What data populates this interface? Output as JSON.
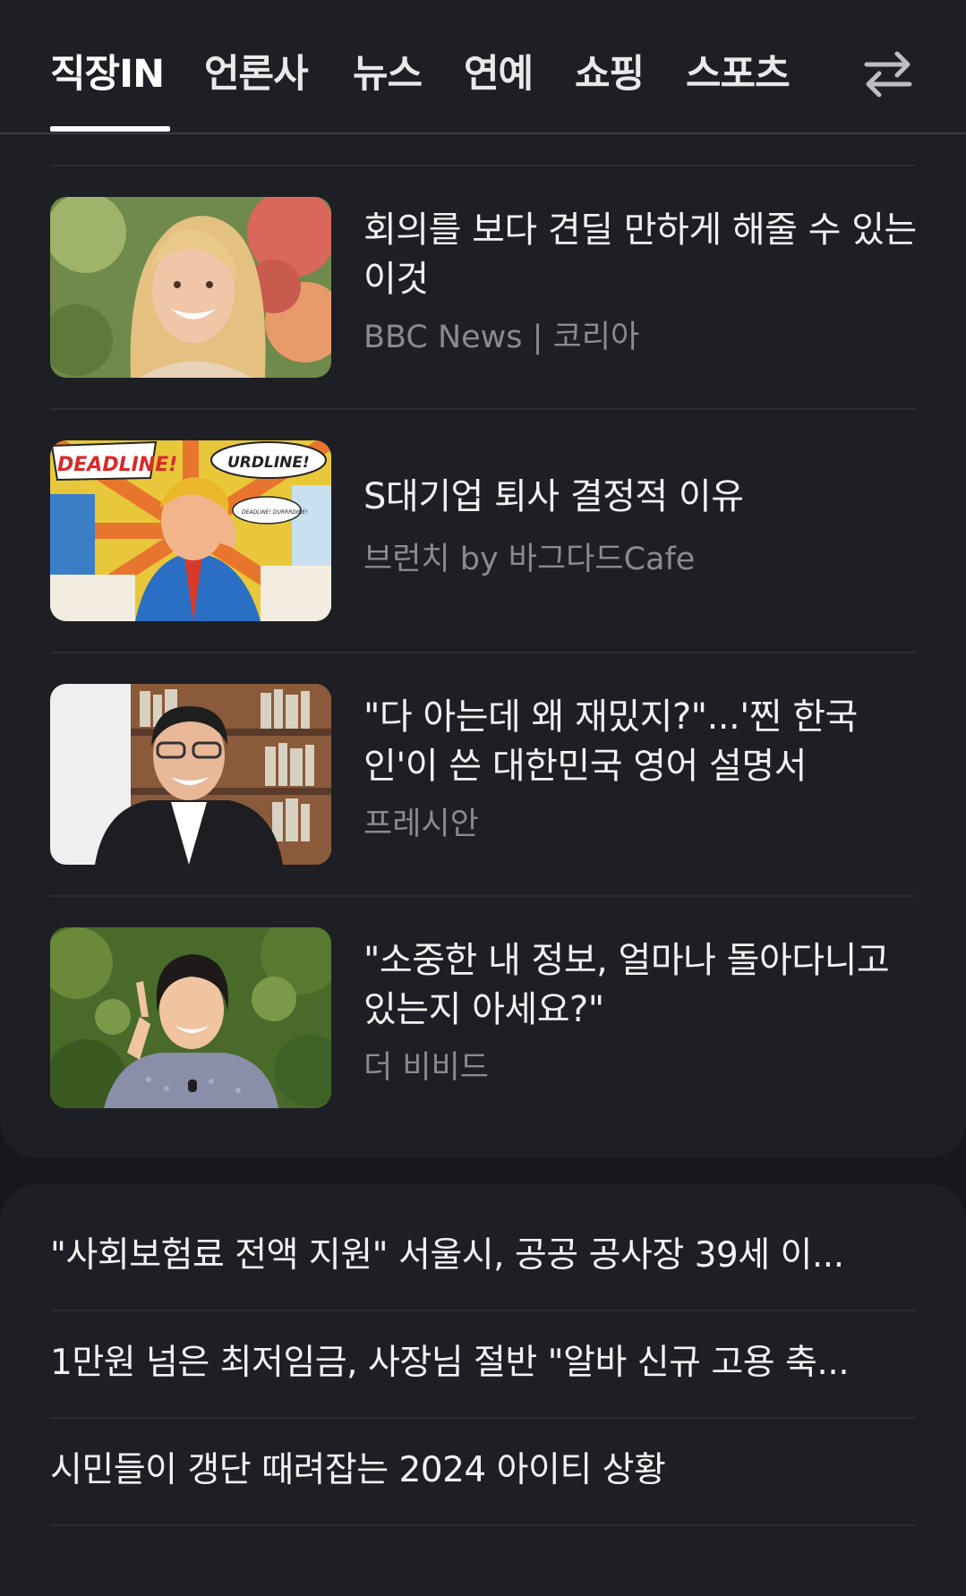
{
  "tabs": [
    {
      "label": "직장IN",
      "active": true
    },
    {
      "label": "언론사",
      "active": false
    },
    {
      "label": "뉴스",
      "active": false
    },
    {
      "label": "연예",
      "active": false
    },
    {
      "label": "쇼핑",
      "active": false
    },
    {
      "label": "스포츠",
      "active": false
    }
  ],
  "swap_icon": "swap-arrows-icon",
  "articles": [
    {
      "title": "회의를 보다 견딜 만하게 해줄 수 있는 이것",
      "source": "BBC News | 코리아",
      "thumbnail": "smiling woman portrait"
    },
    {
      "title": "S대기업 퇴사 결정적 이유",
      "source": "브런치 by 바그다드Cafe",
      "thumbnail": "pop art stressed man with DEADLINE! speech bubbles"
    },
    {
      "title": "\"다 아는데 왜 재밌지?\"...'찐 한국인'이 쓴 대한민국 영어 설명서",
      "source": "프레시안",
      "thumbnail": "smiling man with glasses in front of bookshelf"
    },
    {
      "title": "\"소중한 내 정보, 얼마나 돌아다니고 있는지 아세요?\"",
      "source": "더 비비드",
      "thumbnail": "smiling woman pointing up"
    }
  ],
  "comic_text": {
    "left": "DEADLINE!",
    "right": "URDLINE!",
    "small": "DEADLINE! DURRRDINE!"
  },
  "headlines": [
    "\"사회보험료 전액 지원\" 서울시, 공공 공사장 39세 이...",
    "1만원 넘은 최저임금, 사장님 절반 \"알바 신규 고용 축...",
    "시민들이 갱단 때려잡는 2024 아이티 상황"
  ],
  "colors": {
    "background": "#17181c",
    "card": "#1e1f24",
    "text": "#f2f2f3",
    "muted": "#8a8b90"
  }
}
